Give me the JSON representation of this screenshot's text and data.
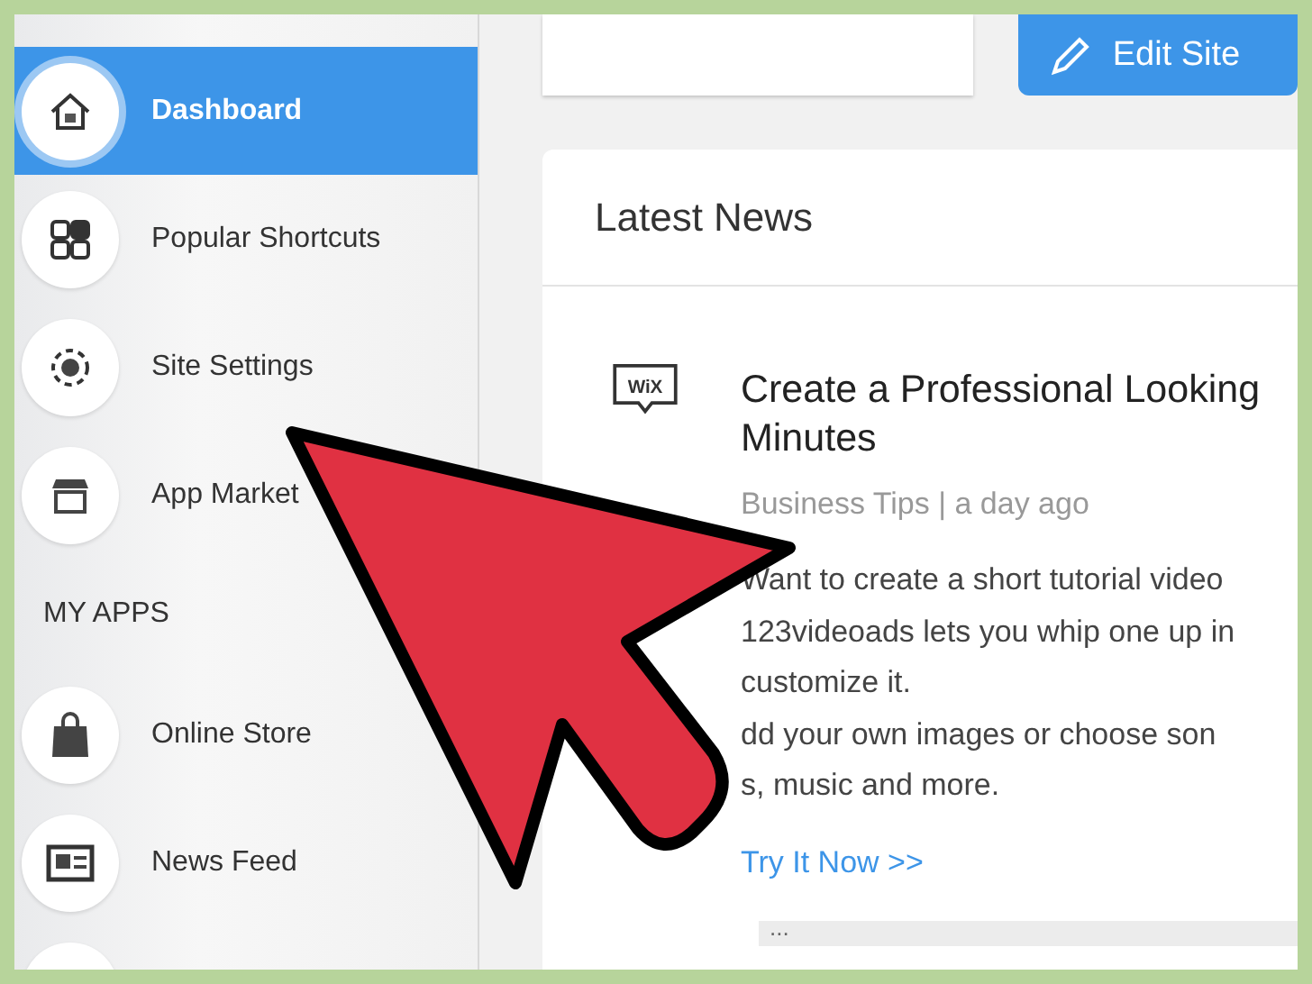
{
  "sidebar": {
    "items": [
      {
        "label": "Dashboard",
        "kind": "home",
        "selected": true
      },
      {
        "label": "Popular Shortcuts",
        "kind": "grid",
        "selected": false
      },
      {
        "label": "Site Settings",
        "kind": "gear",
        "selected": false
      },
      {
        "label": "App Market",
        "kind": "store",
        "selected": false
      }
    ],
    "section_title": "MY APPS",
    "apps": [
      {
        "label": "Online Store",
        "kind": "bag",
        "selected": false
      },
      {
        "label": "News Feed",
        "kind": "news",
        "selected": false
      }
    ]
  },
  "edit_button": "Edit Site",
  "news": {
    "title": "Latest News",
    "item": {
      "logo_text": "WiX",
      "title_lines": [
        "Create a Professional Looking",
        "Minutes"
      ],
      "meta": "Business Tips | a day ago",
      "body_lines": [
        "Want to create a short tutorial video",
        "123videoads lets you whip one up in",
        "customize it.",
        "dd your own images or choose son",
        "s, music and more."
      ],
      "link": "Try It Now >>"
    },
    "more": "..."
  }
}
